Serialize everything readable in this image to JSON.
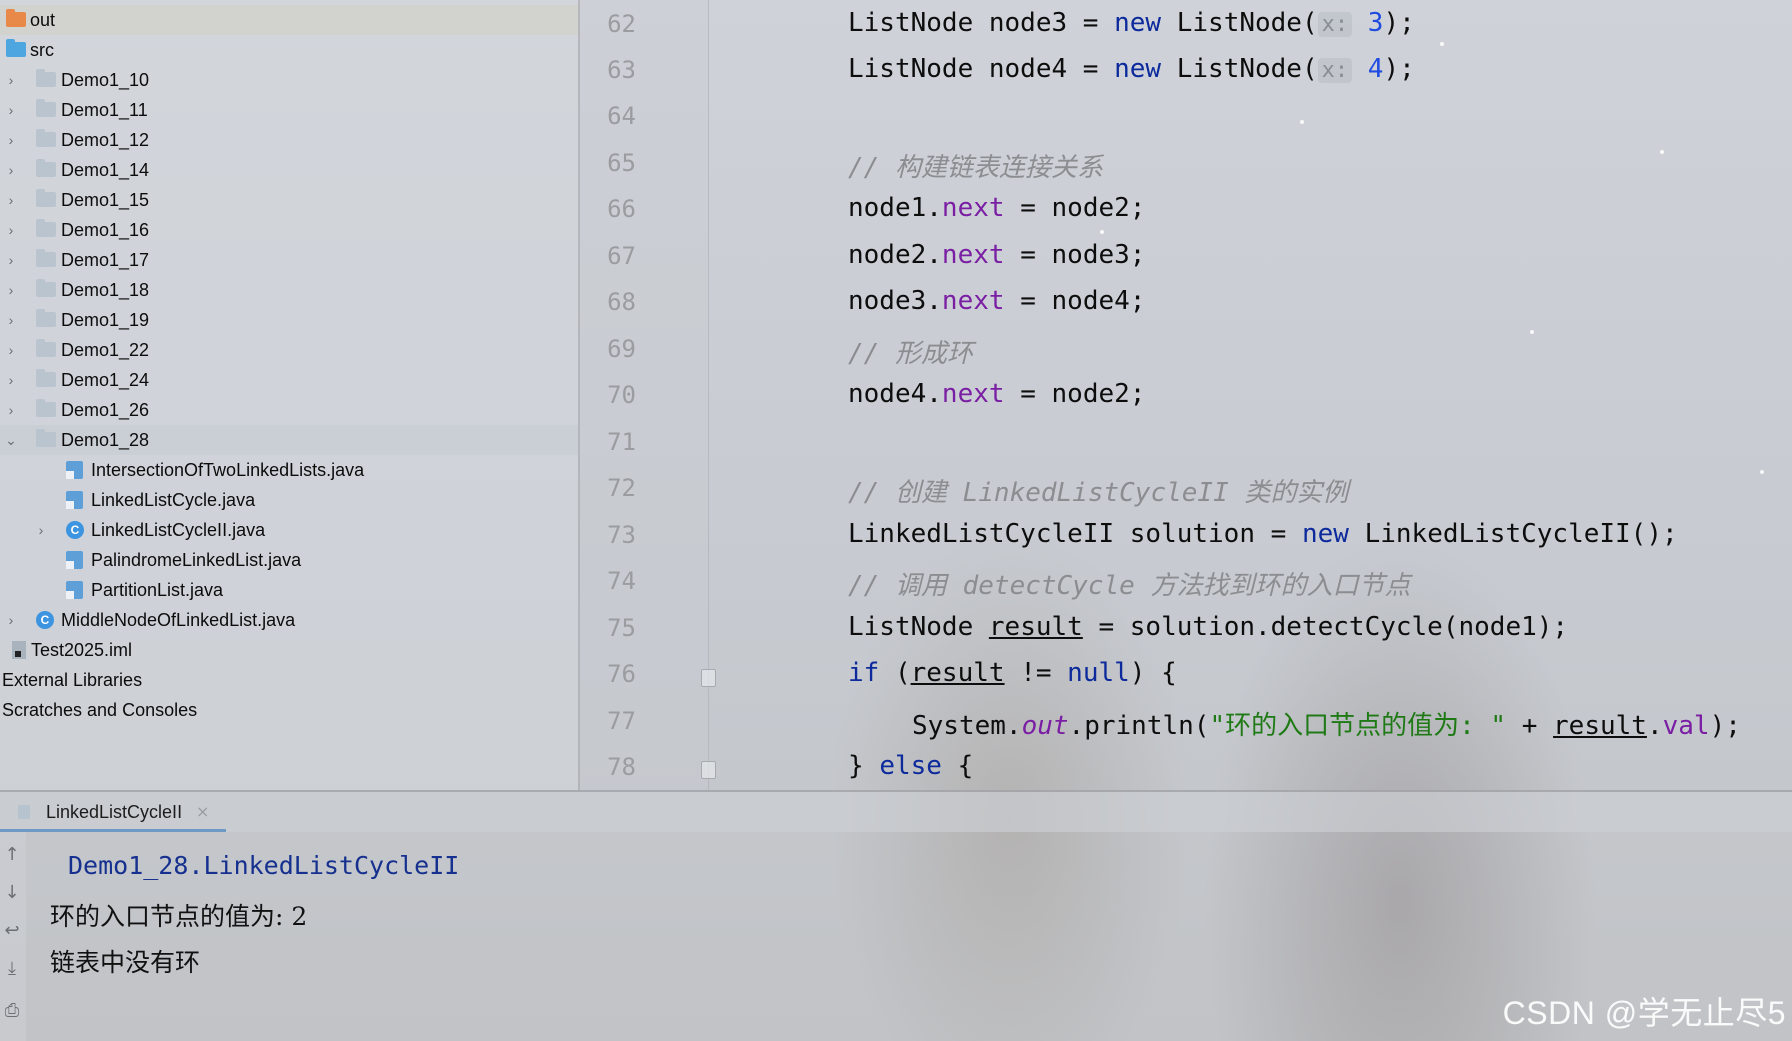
{
  "project_tree": {
    "items": [
      {
        "label": "out",
        "icon": "folder-icon"
      },
      {
        "label": "src",
        "icon": "folder-icon"
      },
      {
        "label": "Demo1_10",
        "icon": "package-icon"
      },
      {
        "label": "Demo1_11",
        "icon": "package-icon"
      },
      {
        "label": "Demo1_12",
        "icon": "package-icon"
      },
      {
        "label": "Demo1_14",
        "icon": "package-icon"
      },
      {
        "label": "Demo1_15",
        "icon": "package-icon"
      },
      {
        "label": "Demo1_16",
        "icon": "package-icon"
      },
      {
        "label": "Demo1_17",
        "icon": "package-icon"
      },
      {
        "label": "Demo1_18",
        "icon": "package-icon"
      },
      {
        "label": "Demo1_19",
        "icon": "package-icon"
      },
      {
        "label": "Demo1_22",
        "icon": "package-icon"
      },
      {
        "label": "Demo1_24",
        "icon": "package-icon"
      },
      {
        "label": "Demo1_26",
        "icon": "package-icon"
      },
      {
        "label": "Demo1_28",
        "icon": "package-icon"
      },
      {
        "label": "IntersectionOfTwoLinkedLists.java",
        "icon": "java-file-icon"
      },
      {
        "label": "LinkedListCycle.java",
        "icon": "java-file-icon"
      },
      {
        "label": "LinkedListCycleII.java",
        "icon": "java-class-icon"
      },
      {
        "label": "PalindromeLinkedList.java",
        "icon": "java-file-icon"
      },
      {
        "label": "PartitionList.java",
        "icon": "java-file-icon"
      },
      {
        "label": "MiddleNodeOfLinkedList.java",
        "icon": "java-class-icon"
      },
      {
        "label": "Test2025.iml",
        "icon": "iml-file-icon"
      },
      {
        "label": "External Libraries",
        "icon": ""
      },
      {
        "label": "Scratches and Consoles",
        "icon": ""
      }
    ]
  },
  "editor": {
    "line_numbers": [
      "62",
      "63",
      "64",
      "65",
      "66",
      "67",
      "68",
      "69",
      "70",
      "71",
      "72",
      "73",
      "74",
      "75",
      "76",
      "77",
      "78"
    ],
    "lines": {
      "l62": {
        "a": "ListNode node3 = ",
        "kw": "new",
        "b": " ListNode(",
        "hint": "x:",
        "num": "3",
        "c": ");"
      },
      "l63": {
        "a": "ListNode node4 = ",
        "kw": "new",
        "b": " ListNode(",
        "hint": "x:",
        "num": "4",
        "c": ");"
      },
      "l65": {
        "cmt": "// 构建链表连接关系"
      },
      "l66": {
        "a": "node1.",
        "fld": "next",
        "b": " = node2;"
      },
      "l67": {
        "a": "node2.",
        "fld": "next",
        "b": " = node3;"
      },
      "l68": {
        "a": "node3.",
        "fld": "next",
        "b": " = node4;"
      },
      "l69": {
        "cmt": "// 形成环"
      },
      "l70": {
        "a": "node4.",
        "fld": "next",
        "b": " = node2;"
      },
      "l72": {
        "cmt": "// 创建 LinkedListCycleII 类的实例"
      },
      "l73": {
        "a": "LinkedListCycleII solution = ",
        "kw": "new",
        "b": " LinkedListCycleII();"
      },
      "l74": {
        "cmt": "// 调用 detectCycle 方法找到环的入口节点"
      },
      "l75": {
        "a": "ListNode ",
        "u": "result",
        "b": " = solution.detectCycle(node1);"
      },
      "l76": {
        "kw": "if",
        "a": " (",
        "u": "result",
        "b": " != ",
        "kw2": "null",
        "c": ") {"
      },
      "l77": {
        "a": "System.",
        "ital": "out",
        "b": ".println(",
        "str": "\"环的入口节点的值为: \"",
        "c": " + ",
        "u": "result",
        "d": ".",
        "fld": "val",
        "e": ");"
      },
      "l78": {
        "a": "} ",
        "kw": "else",
        "b": " {"
      }
    }
  },
  "run_panel": {
    "tab_label": "LinkedListCycleII",
    "tab_close": "×",
    "output": [
      "Demo1_28.LinkedListCycleII",
      "环的入口节点的值为: 2",
      "链表中没有环"
    ]
  },
  "watermark": "CSDN @学无止尽5"
}
